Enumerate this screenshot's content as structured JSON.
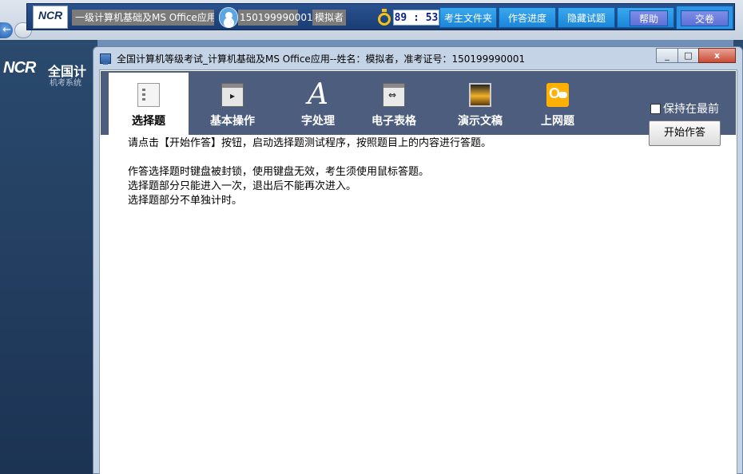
{
  "topbar": {
    "logo_text": "NCR",
    "subject": "一级计算机基础及MS Office应用",
    "exam_id": "150199990001",
    "candidate": "模拟者",
    "timer": "89 : 53",
    "buttons": [
      "考生文件夹",
      "作答进度",
      "隐藏试题",
      "帮助",
      "交卷"
    ]
  },
  "background_logo": {
    "mark": "NCR",
    "title": "全国计",
    "subtitle": "机考系统"
  },
  "window": {
    "title": "全国计算机等级考试_计算机基础及MS Office应用--姓名：模拟者，准考证号：150199990001",
    "controls": [
      "_",
      "□",
      "x"
    ]
  },
  "tabs": [
    {
      "label": "选择题",
      "icon": "document-list-icon",
      "active": true
    },
    {
      "label": "基本操作",
      "icon": "window-icon",
      "active": false
    },
    {
      "label": "字处理",
      "icon": "letter-a-icon",
      "active": false
    },
    {
      "label": "电子表格",
      "icon": "spreadsheet-icon",
      "active": false
    },
    {
      "label": "演示文稿",
      "icon": "slide-icon",
      "active": false
    },
    {
      "label": "上网题",
      "icon": "web-icon",
      "active": false
    }
  ],
  "keep_on_top_label": "保持在最前",
  "start_button_label": "开始作答",
  "instructions": [
    "请点击【开始作答】按钮，启动选择题测试程序，按照题目上的内容进行答题。",
    "作答选择题时键盘被封锁，使用键盘无效，考生须使用鼠标答题。",
    "选择题部分只能进入一次，退出后不能再次进入。",
    "选择题部分不单独计时。"
  ],
  "colors": {
    "topbar": "#1f4680",
    "ribbon": "#4d5d7d",
    "button_blue": "#2a97e6",
    "button_purple": "#6d7ee0",
    "timer_text": "#0a1f86"
  }
}
